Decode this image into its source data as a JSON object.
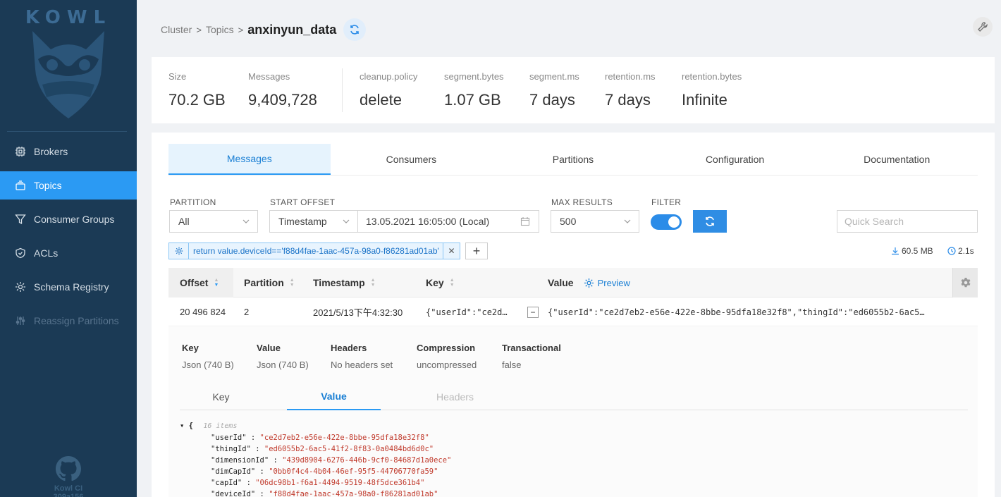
{
  "app": {
    "logo_text": "KOWL",
    "footer_name": "Kowl CI",
    "footer_version": "309a156"
  },
  "sidebar": {
    "items": [
      {
        "label": "Brokers",
        "icon": "cpu-icon",
        "active": false,
        "disabled": false
      },
      {
        "label": "Topics",
        "icon": "layers-icon",
        "active": true,
        "disabled": false
      },
      {
        "label": "Consumer Groups",
        "icon": "funnel-icon",
        "active": false,
        "disabled": false
      },
      {
        "label": "ACLs",
        "icon": "shield-icon",
        "active": false,
        "disabled": false
      },
      {
        "label": "Schema Registry",
        "icon": "gear-icon",
        "active": false,
        "disabled": false
      },
      {
        "label": "Reassign Partitions",
        "icon": "sliders-icon",
        "active": false,
        "disabled": true
      }
    ]
  },
  "breadcrumb": {
    "cluster": "Cluster",
    "topics": "Topics",
    "current": "anxinyun_data"
  },
  "stats": {
    "size": {
      "label": "Size",
      "value": "70.2 GB"
    },
    "messages": {
      "label": "Messages",
      "value": "9,409,728"
    },
    "cleanup": {
      "label": "cleanup.policy",
      "value": "delete"
    },
    "segment_bytes": {
      "label": "segment.bytes",
      "value": "1.07 GB"
    },
    "segment_ms": {
      "label": "segment.ms",
      "value": "7 days"
    },
    "retention_ms": {
      "label": "retention.ms",
      "value": "7 days"
    },
    "retention_bytes": {
      "label": "retention.bytes",
      "value": "Infinite"
    }
  },
  "tabs": [
    "Messages",
    "Consumers",
    "Partitions",
    "Configuration",
    "Documentation"
  ],
  "filters": {
    "partition_label": "PARTITION",
    "partition_value": "All",
    "start_offset_label": "START OFFSET",
    "start_offset_value": "Timestamp",
    "date_value": "13.05.2021 16:05:00 (Local)",
    "max_results_label": "MAX RESULTS",
    "max_results_value": "500",
    "filter_label": "FILTER",
    "filter_enabled": true,
    "search_placeholder": "Quick Search",
    "filter_code": "return value.deviceId=='f88d4fae-1aac-457a-98a0-f86281ad01ab'",
    "size_stat": "60.5 MB",
    "time_stat": "2.1s"
  },
  "table": {
    "headers": {
      "offset": "Offset",
      "partition": "Partition",
      "timestamp": "Timestamp",
      "key": "Key",
      "value": "Value",
      "preview": "Preview"
    },
    "row": {
      "offset": "20 496 824",
      "partition": "2",
      "timestamp": "2021/5/13下午4:32:30",
      "key": "{\"userId\":\"ce2d…",
      "value": "{\"userId\":\"ce2d7eb2-e56e-422e-8bbe-95dfa18e32f8\",\"thingId\":\"ed6055b2-6ac5…"
    }
  },
  "details": {
    "key": {
      "label": "Key",
      "value": "Json (740 B)"
    },
    "value": {
      "label": "Value",
      "value": "Json (740 B)"
    },
    "headers": {
      "label": "Headers",
      "value": "No headers set"
    },
    "compression": {
      "label": "Compression",
      "value": "uncompressed"
    },
    "transactional": {
      "label": "Transactional",
      "value": "false"
    },
    "subtabs": [
      "Key",
      "Value",
      "Headers"
    ]
  },
  "json_view": {
    "open_brace": "{",
    "count": "16 items",
    "fields": [
      {
        "key": "\"userId\"",
        "value": "\"ce2d7eb2-e56e-422e-8bbe-95dfa18e32f8\""
      },
      {
        "key": "\"thingId\"",
        "value": "\"ed6055b2-6ac5-41f2-8f83-0a0484bd6d0c\""
      },
      {
        "key": "\"dimensionId\"",
        "value": "\"439d8904-6276-446b-9cf0-84687d1a0ece\""
      },
      {
        "key": "\"dimCapId\"",
        "value": "\"0bb0f4c4-4b04-46ef-95f5-44706770fa59\""
      },
      {
        "key": "\"capId\"",
        "value": "\"06dc98b1-f6a1-4494-9519-48f5dce361b4\""
      },
      {
        "key": "\"deviceId\"",
        "value": "\"f88d4fae-1aac-457a-98a0-f86281ad01ab\""
      }
    ]
  },
  "colors": {
    "sidebar_bg": "#1b3a55",
    "accent": "#2b9af3",
    "string": "#c0392b"
  }
}
